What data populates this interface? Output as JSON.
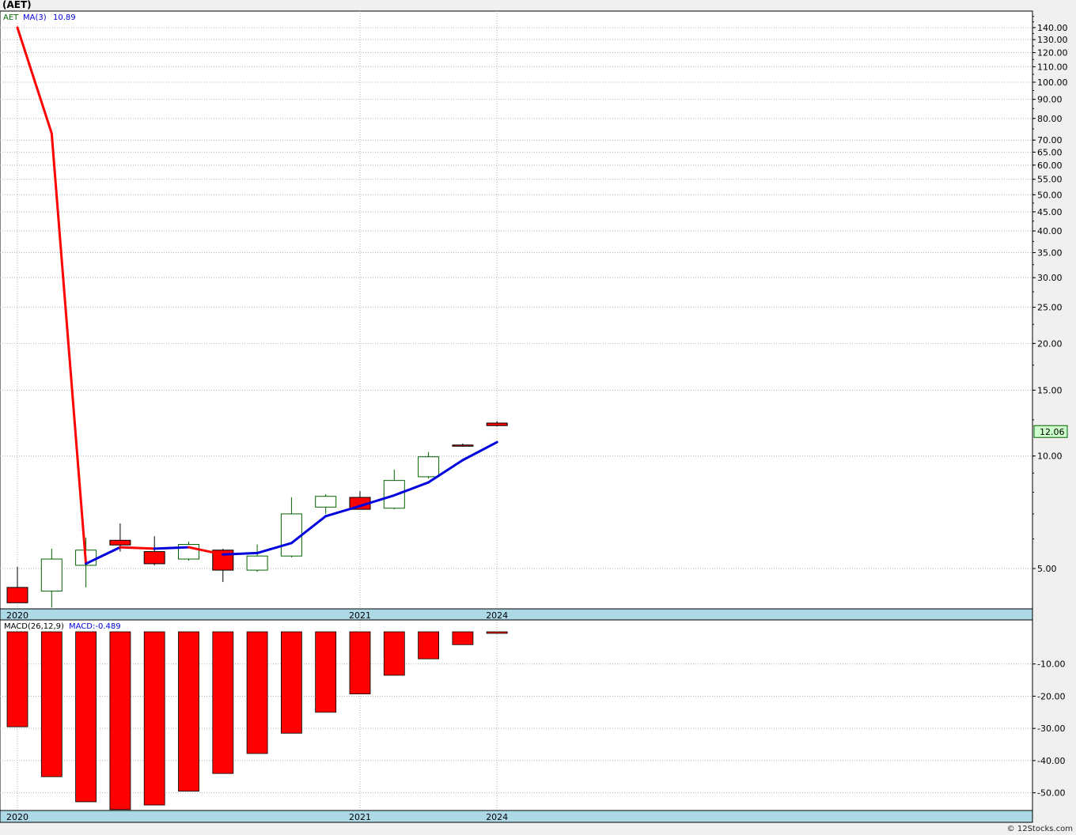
{
  "page": {
    "title": "(AET)",
    "footer": "© 12Stocks.com"
  },
  "colors": {
    "up_candle": "#006400",
    "down_candle": "#ff0000",
    "ma_line": "#0000dd",
    "macd_bar": "#ff0000",
    "date_band": "#add8e6",
    "last_price_label_bg": "#ccffcc"
  },
  "chart_data": [
    {
      "type": "candlestick",
      "symbol_label": "AET",
      "indicator_label": "MA(3)",
      "indicator_value": "10.89",
      "last_price_label": "12.06",
      "y_scale": "log",
      "ylim": [
        3.9,
        155
      ],
      "y_ticks": [
        5,
        10,
        15,
        20,
        25,
        30,
        35,
        40,
        45,
        50,
        55,
        60,
        65,
        70,
        80,
        90,
        100,
        110,
        120,
        130,
        140
      ],
      "y_tick_labels": [
        "5.00",
        "10.00",
        "15.00",
        "20.00",
        "25.00",
        "30.00",
        "35.00",
        "40.00",
        "45.00",
        "50.00",
        "55.00",
        "60.00",
        "65.00",
        "70.00",
        "80.00",
        "90.00",
        "100.00",
        "110.00",
        "120.00",
        "130.00",
        "140.00"
      ],
      "x_labels": [
        {
          "label": "2020",
          "index": 0
        },
        {
          "label": "2021",
          "index": 10
        },
        {
          "label": "2024",
          "index": 14
        }
      ],
      "bars": [
        {
          "open": 4.45,
          "high": 5.05,
          "low": 4.05,
          "close": 4.05
        },
        {
          "open": 4.35,
          "high": 5.65,
          "low": 3.93,
          "close": 5.3
        },
        {
          "open": 5.1,
          "high": 6.05,
          "low": 4.45,
          "close": 5.6
        },
        {
          "open": 5.95,
          "high": 6.6,
          "low": 5.55,
          "close": 5.78
        },
        {
          "open": 5.55,
          "high": 6.1,
          "low": 5.1,
          "close": 5.15
        },
        {
          "open": 5.3,
          "high": 5.9,
          "low": 5.25,
          "close": 5.8
        },
        {
          "open": 5.6,
          "high": 5.65,
          "low": 4.6,
          "close": 4.95
        },
        {
          "open": 4.95,
          "high": 5.8,
          "low": 4.9,
          "close": 5.4
        },
        {
          "open": 5.4,
          "high": 7.75,
          "low": 5.35,
          "close": 7.0
        },
        {
          "open": 7.3,
          "high": 7.9,
          "low": 7.0,
          "close": 7.8
        },
        {
          "open": 7.75,
          "high": 8.05,
          "low": 7.2,
          "close": 7.2
        },
        {
          "open": 7.25,
          "high": 9.2,
          "low": 7.2,
          "close": 8.6
        },
        {
          "open": 8.8,
          "high": 10.25,
          "low": 8.7,
          "close": 9.95
        },
        {
          "open": 10.7,
          "high": 10.8,
          "low": 10.6,
          "close": 10.65
        },
        {
          "open": 12.25,
          "high": 12.4,
          "low": 12.0,
          "close": 12.06
        }
      ],
      "ma": [
        140.0,
        73.0,
        5.15,
        5.7,
        5.65,
        5.7,
        5.45,
        5.5,
        5.85,
        6.9,
        7.35,
        7.85,
        8.5,
        9.75,
        10.89
      ],
      "ma_red_segments": [
        [
          0,
          2
        ],
        [
          3,
          4
        ],
        [
          5,
          6
        ]
      ]
    },
    {
      "type": "bar",
      "indicator_label": "MACD(26,12,9)",
      "indicator_value": "MACD:-0.489",
      "ylim": [
        -55.5,
        0
      ],
      "y_ticks": [
        -10,
        -20,
        -30,
        -40,
        -50
      ],
      "y_tick_labels": [
        "-10.00",
        "-20.00",
        "-30.00",
        "-40.00",
        "-50.00"
      ],
      "x_labels": [
        {
          "label": "2020",
          "index": 0
        },
        {
          "label": "2021",
          "index": 10
        },
        {
          "label": "2024",
          "index": 14
        }
      ],
      "values": [
        -29.5,
        -45.0,
        -52.8,
        -55.2,
        -53.8,
        -49.5,
        -44.0,
        -37.8,
        -31.5,
        -25.0,
        -19.3,
        -13.5,
        -8.4,
        -4.0,
        -0.489
      ]
    }
  ]
}
